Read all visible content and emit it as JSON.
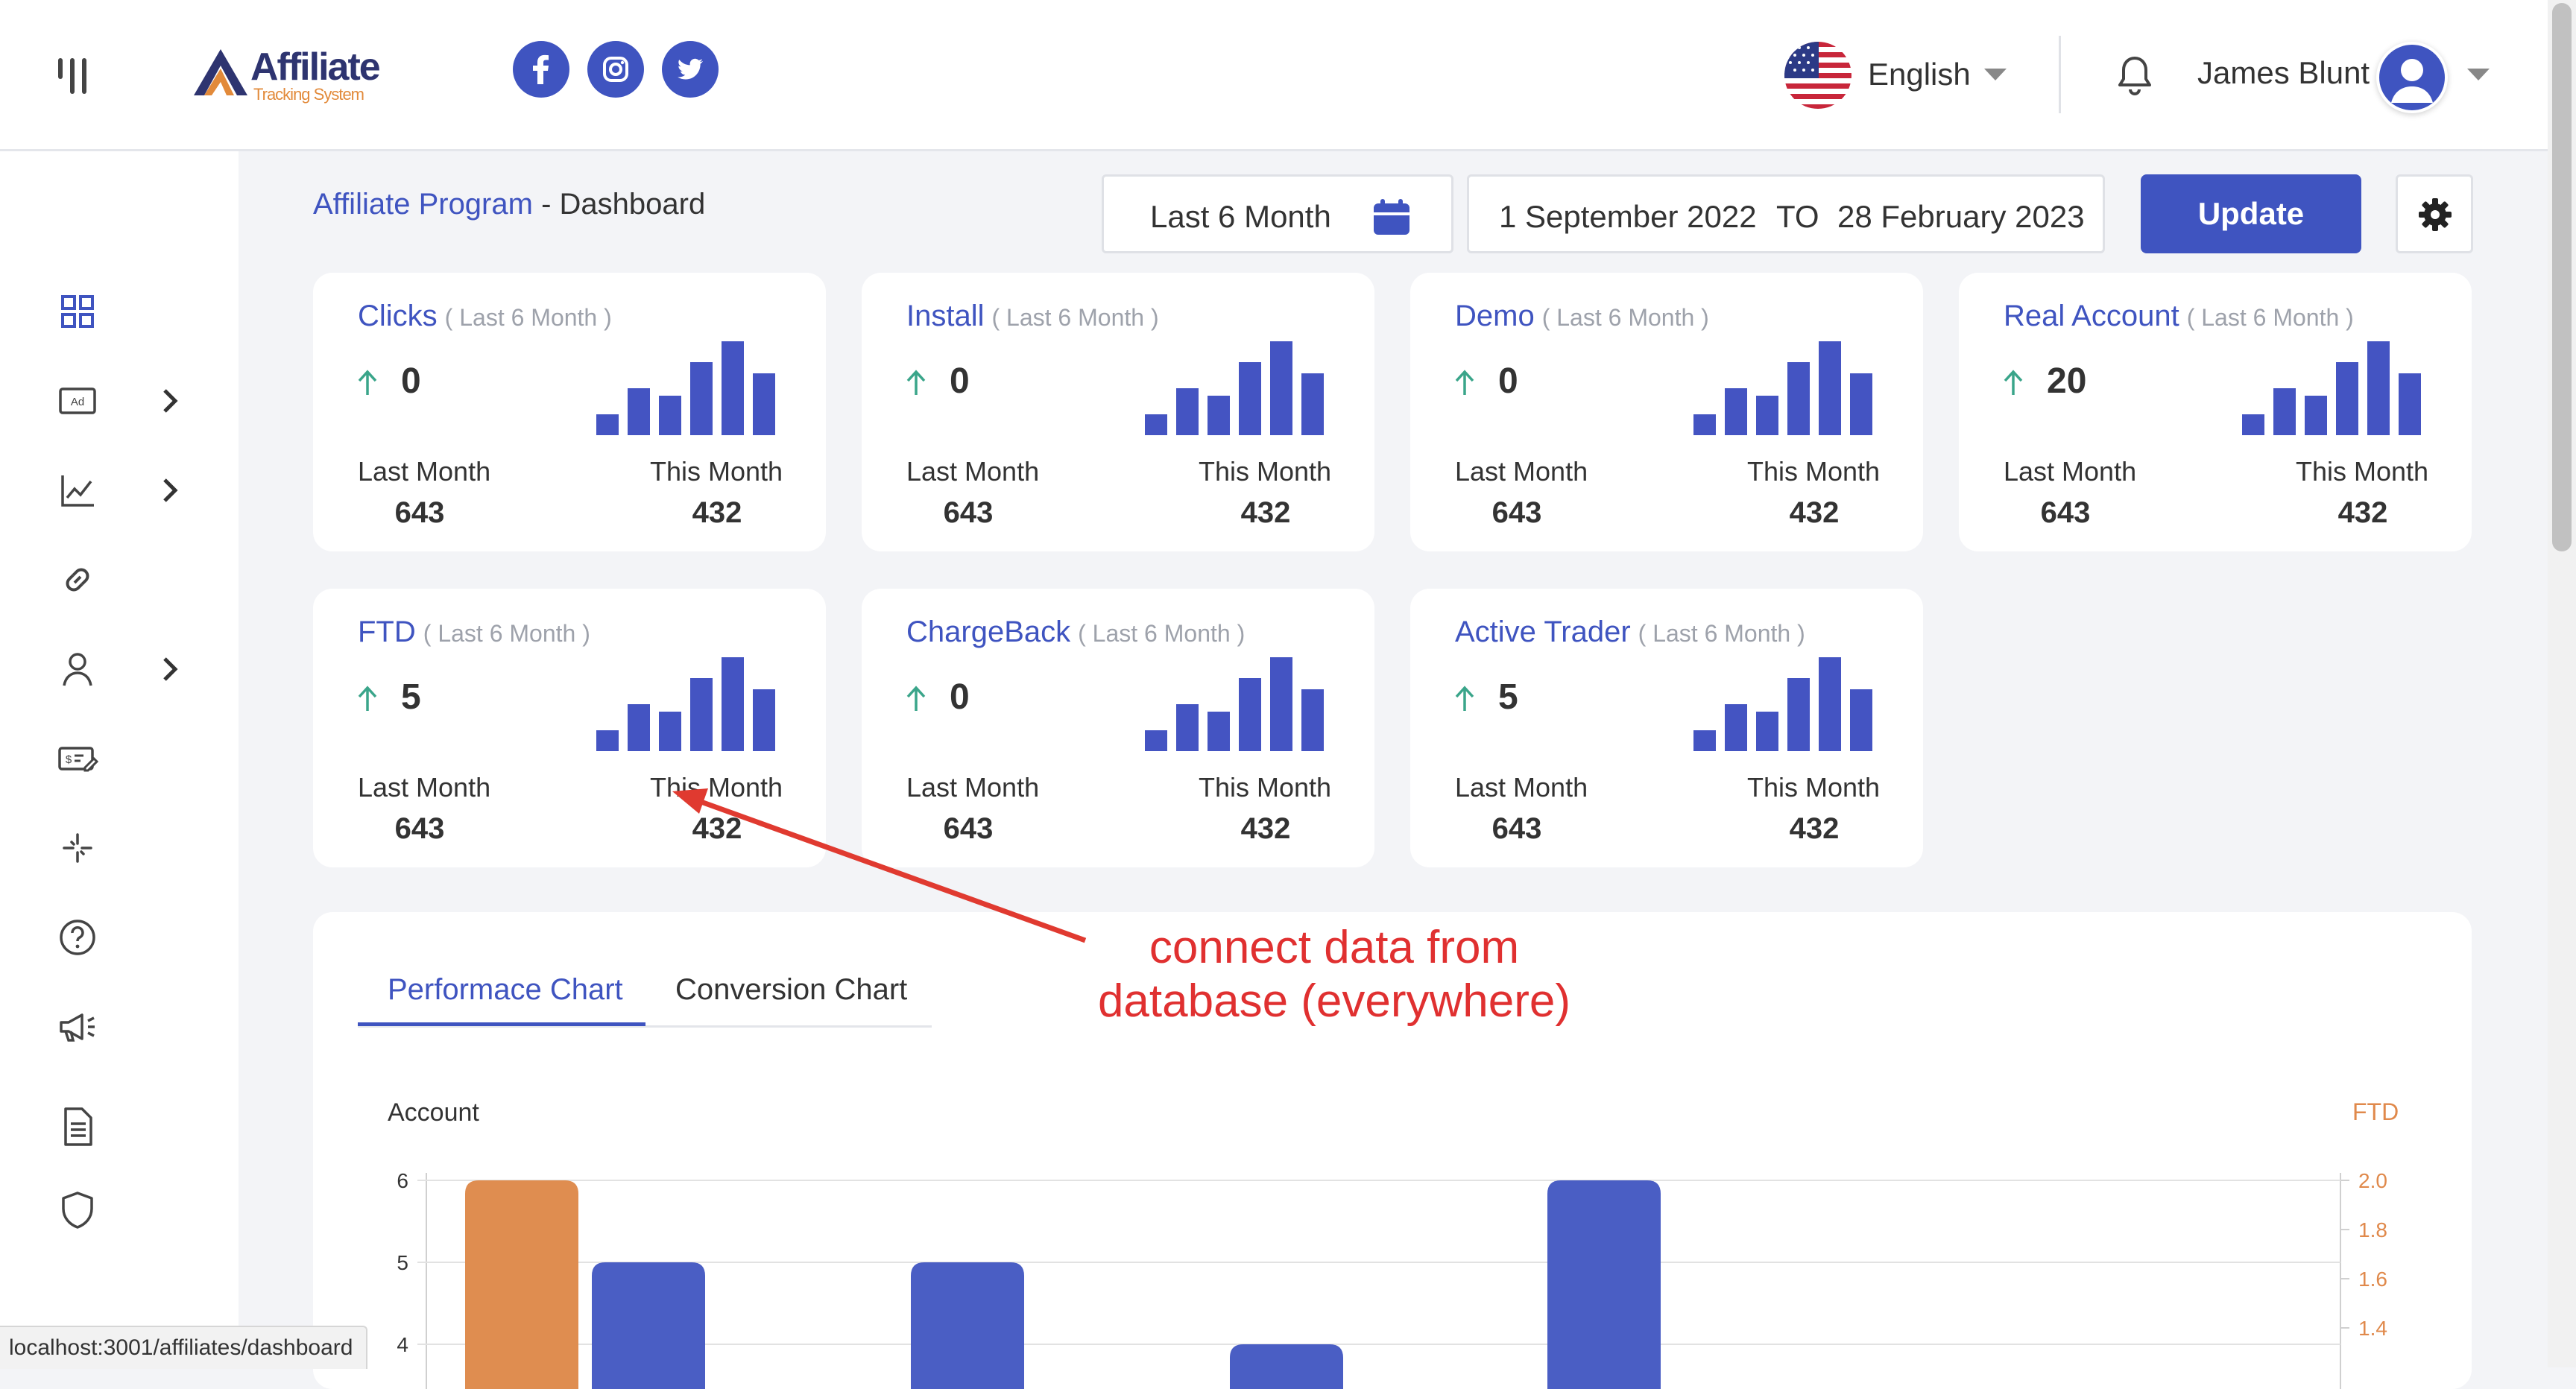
{
  "header": {
    "logo_main": "Affiliate",
    "logo_sub": "Tracking System",
    "social": [
      "facebook-icon",
      "instagram-icon",
      "twitter-icon"
    ],
    "language": "English",
    "user_name": "James Blunt"
  },
  "sidebar": {
    "items": [
      {
        "icon": "dashboard-grid-icon",
        "has_submenu": false
      },
      {
        "icon": "ad-icon",
        "has_submenu": true
      },
      {
        "icon": "line-chart-icon",
        "has_submenu": true
      },
      {
        "icon": "link-icon",
        "has_submenu": false
      },
      {
        "icon": "user-icon",
        "has_submenu": true
      },
      {
        "icon": "payment-icon",
        "has_submenu": false
      },
      {
        "icon": "sparkle-icon",
        "has_submenu": false
      },
      {
        "icon": "help-icon",
        "has_submenu": false
      },
      {
        "icon": "megaphone-icon",
        "has_submenu": false
      },
      {
        "icon": "document-icon",
        "has_submenu": false
      },
      {
        "icon": "shield-icon",
        "has_submenu": false
      }
    ]
  },
  "status_url": "localhost:3001/affiliates/dashboard",
  "breadcrumb": {
    "section": "Affiliate Program",
    "separator": " - ",
    "page": "Dashboard"
  },
  "filters": {
    "period": "Last 6 Month",
    "date_from": "1 September 2022",
    "to_label": "TO",
    "date_to": "28 February 2023",
    "update_label": "Update"
  },
  "cards": [
    {
      "title": "Clicks",
      "subtitle": "( Last 6 Month )",
      "value": "0",
      "last_label": "Last Month",
      "last_value": "643",
      "this_label": "This Month",
      "this_value": "432",
      "spark": [
        0.22,
        0.5,
        0.42,
        0.78,
        1.0,
        0.66
      ]
    },
    {
      "title": "Install",
      "subtitle": "( Last 6 Month )",
      "value": "0",
      "last_label": "Last Month",
      "last_value": "643",
      "this_label": "This Month",
      "this_value": "432",
      "spark": [
        0.22,
        0.5,
        0.42,
        0.78,
        1.0,
        0.66
      ]
    },
    {
      "title": "Demo",
      "subtitle": "( Last 6 Month )",
      "value": "0",
      "last_label": "Last Month",
      "last_value": "643",
      "this_label": "This Month",
      "this_value": "432",
      "spark": [
        0.22,
        0.5,
        0.42,
        0.78,
        1.0,
        0.66
      ]
    },
    {
      "title": "Real Account",
      "subtitle": "( Last 6 Month )",
      "value": "20",
      "last_label": "Last Month",
      "last_value": "643",
      "this_label": "This Month",
      "this_value": "432",
      "spark": [
        0.22,
        0.5,
        0.42,
        0.78,
        1.0,
        0.66
      ]
    },
    {
      "title": "FTD",
      "subtitle": "( Last 6 Month )",
      "value": "5",
      "last_label": "Last Month",
      "last_value": "643",
      "this_label": "This Month",
      "this_value": "432",
      "spark": [
        0.22,
        0.5,
        0.42,
        0.78,
        1.0,
        0.66
      ]
    },
    {
      "title": "ChargeBack",
      "subtitle": "( Last 6 Month )",
      "value": "0",
      "last_label": "Last Month",
      "last_value": "643",
      "this_label": "This Month",
      "this_value": "432",
      "spark": [
        0.22,
        0.5,
        0.42,
        0.78,
        1.0,
        0.66
      ]
    },
    {
      "title": "Active Trader",
      "subtitle": "( Last 6 Month )",
      "value": "5",
      "last_label": "Last Month",
      "last_value": "643",
      "this_label": "This Month",
      "this_value": "432",
      "spark": [
        0.22,
        0.5,
        0.42,
        0.78,
        1.0,
        0.66
      ]
    }
  ],
  "chart": {
    "tabs": [
      "Performace Chart",
      "Conversion Chart"
    ],
    "active_tab": 0
  },
  "chart_data": {
    "type": "bar",
    "xlabel": "",
    "ylabel": "Account",
    "ylabel_right": "FTD",
    "y_ticks_left": [
      "6",
      "5",
      "4"
    ],
    "y_ticks_right": [
      "2.0",
      "1.8",
      "1.6",
      "1.4"
    ],
    "ylim_visible": [
      4,
      6
    ],
    "ylim_right_visible": [
      1.4,
      2.0
    ],
    "colors": {
      "ftd": "#df8d50",
      "account": "#4a5ec4"
    },
    "bars": [
      {
        "series": "FTD",
        "slot": 0,
        "value": 2.0
      },
      {
        "series": "Account",
        "slot": 1,
        "value": 5
      },
      {
        "series": "Account",
        "slot": 2,
        "value": 5
      },
      {
        "series": "Account",
        "slot": 3,
        "value": 4
      },
      {
        "series": "Account",
        "slot": 4,
        "value": 6
      }
    ],
    "grid": true
  },
  "annotation": {
    "line1": "connect data from",
    "line2": "database (everywhere)"
  },
  "colors": {
    "primary": "#3f54c0",
    "accent": "#e28a3a",
    "annotation": "#e03030"
  }
}
